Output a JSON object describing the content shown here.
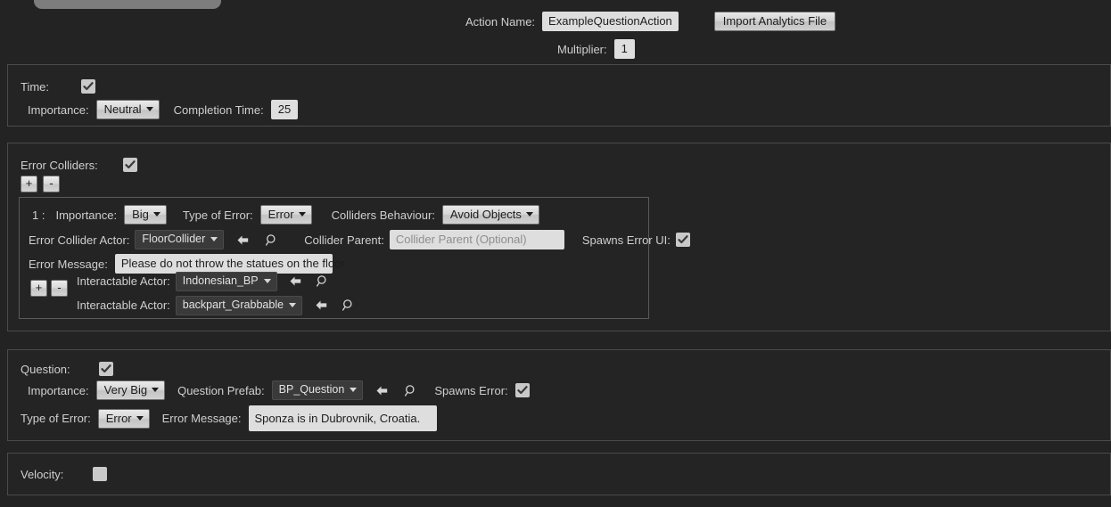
{
  "header": {
    "action_name_label": "Action Name:",
    "action_name_value": "ExampleQuestionAction",
    "import_button": "Import Analytics File",
    "multiplier_label": "Multiplier:",
    "multiplier_value": "1"
  },
  "time_section": {
    "title": "Time:",
    "enabled": true,
    "importance_label": "Importance:",
    "importance_value": "Neutral",
    "completion_label": "Completion Time:",
    "completion_value": "25"
  },
  "error_colliders_section": {
    "title": "Error Colliders:",
    "enabled": true,
    "add_button": "+",
    "remove_button": "-",
    "entry": {
      "index_label": "1 :",
      "importance_label": "Importance:",
      "importance_value": "Big",
      "type_of_error_label": "Type of Error:",
      "type_of_error_value": "Error",
      "colliders_behaviour_label": "Colliders Behaviour:",
      "colliders_behaviour_value": "Avoid Objects",
      "error_collider_actor_label": "Error Collider Actor:",
      "error_collider_actor_value": "FloorCollider",
      "collider_parent_label": "Collider Parent:",
      "collider_parent_placeholder": "Collider Parent (Optional)",
      "spawns_error_ui_label": "Spawns Error UI:",
      "spawns_error_ui_checked": true,
      "error_message_label": "Error Message:",
      "error_message_value": "Please do not throw the statues on the floor.",
      "actors_add_button": "+",
      "actors_remove_button": "-",
      "interactable_actors": [
        {
          "label": "Interactable Actor:",
          "value": "Indonesian_BP"
        },
        {
          "label": "Interactable Actor:",
          "value": "backpart_Grabbable"
        }
      ]
    }
  },
  "question_section": {
    "title": "Question:",
    "enabled": true,
    "importance_label": "Importance:",
    "importance_value": "Very Big",
    "question_prefab_label": "Question Prefab:",
    "question_prefab_value": "BP_Question",
    "spawns_error_label": "Spawns Error:",
    "spawns_error_checked": true,
    "type_of_error_label": "Type of Error:",
    "type_of_error_value": "Error",
    "error_message_label": "Error Message:",
    "error_message_value": "Sponza is in Dubrovnik, Croatia."
  },
  "velocity_section": {
    "title": "Velocity:",
    "enabled": false
  },
  "icons": {
    "back_arrow": "back-arrow-icon",
    "magnifier": "magnifier-icon",
    "caret": "chevron-down-icon",
    "checkmark": "check-icon"
  },
  "colors": {
    "window_bg": "#232323",
    "panel_bg": "#242424",
    "panel_border": "#4b4b4b",
    "inner_border": "#5a5a5a",
    "label_text": "#cfcfcf",
    "field_bg": "#dedede",
    "objpick_bg": "#3a3a3a",
    "tab_active": "#7d7d7d"
  }
}
